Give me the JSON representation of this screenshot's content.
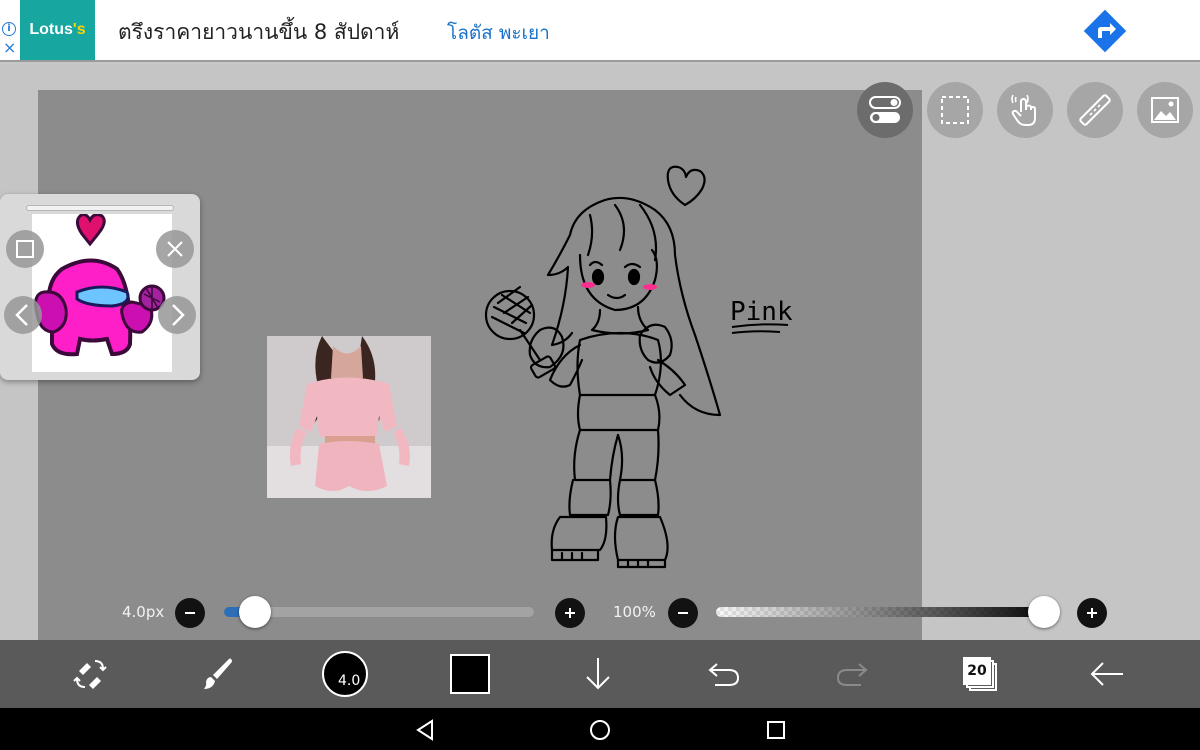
{
  "ad": {
    "info_glyph": "i",
    "close_glyph": "×",
    "brand_name": "Lotus",
    "brand_suffix": "'s",
    "headline": "ตรึงราคายาวนานขึ้น 8 สัปดาห์",
    "store": "โลตัส พะเยา",
    "icons": [
      "info-icon",
      "close-icon",
      "directions-icon"
    ],
    "brand_color": "#17a6a0",
    "link_color": "#1a73c9"
  },
  "top_tools": [
    {
      "name": "layer-toggle",
      "icon": "toggle-icon",
      "active": true
    },
    {
      "name": "selection",
      "icon": "selection-icon",
      "active": false
    },
    {
      "name": "gesture",
      "icon": "hand-gesture-icon",
      "active": false
    },
    {
      "name": "ruler",
      "icon": "ruler-icon",
      "active": false
    },
    {
      "name": "image-import",
      "icon": "image-icon",
      "active": false
    }
  ],
  "drawing": {
    "text": "Pink"
  },
  "brush": {
    "size_label": "4.0px",
    "size_fraction": 0.06
  },
  "opacity": {
    "label": "100%",
    "fraction": 1.0
  },
  "toolbar": {
    "brush_size_display": "4.0",
    "current_color": "#000000",
    "layer_count": "20",
    "icons": [
      "transform-icon",
      "brush-icon",
      "brush-size-preview",
      "color-swatch",
      "download-icon",
      "undo-icon",
      "redo-icon",
      "layers-icon",
      "back-icon"
    ]
  },
  "android_nav": [
    "back-triangle-icon",
    "home-circle-icon",
    "recents-square-icon"
  ]
}
